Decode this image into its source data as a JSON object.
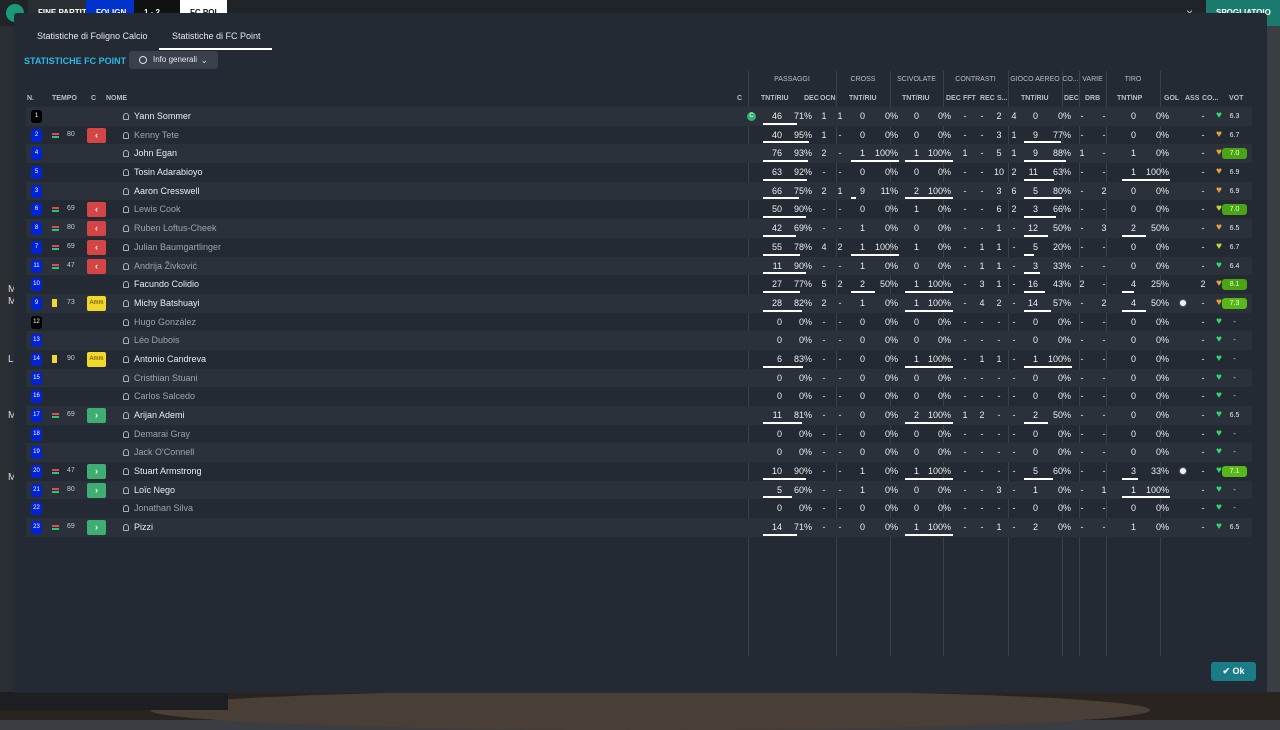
{
  "topbar": {
    "end_label": "FINE PARTITA",
    "home_team": "FOLIGN",
    "score": "1 - 2",
    "away_team": "FC POI",
    "right_label": "SPOGLIATOIO",
    "close_glyph": "×"
  },
  "left_letters": [
    "M",
    "M",
    "L",
    "M",
    "M"
  ],
  "tabs": [
    {
      "label": "Statistiche di Foligno Calcio"
    },
    {
      "label": "Statistiche di FC Point"
    }
  ],
  "section_title": "STATISTICHE FC POINT",
  "view_select": {
    "label": "Info generali"
  },
  "group_headers": {
    "passaggi": "PASSAGGI",
    "cross": "CROSS",
    "scivolate": "SCIVOLATE",
    "contrasti": "CONTRASTI",
    "gioco_aereo": "GIOCO AEREO",
    "co": "CO...",
    "varie": "VARIE",
    "tiro": "TIRO"
  },
  "columns": {
    "n": "N.",
    "tempo": "TEMPO",
    "c": "C",
    "nome": "NOME",
    "c2": "C",
    "pass_tnt": "TNT/RIU",
    "pass_dec": "DEC",
    "pass_ocn": "OCN",
    "cross_tnt": "TNT/RIU",
    "sciv_tnt": "TNT/RIU",
    "contr_dec": "DEC",
    "contr_fft": "FFT",
    "contr_rec": "REC",
    "contr_s": "S...",
    "aereo_tnt": "TNT/RIU",
    "co_dec": "DEC",
    "varie_drb": "DRB",
    "tiro_tnt": "TNT\\NP",
    "gol": "GOL",
    "ass": "ASS",
    "co2": "CO...",
    "vot": "VOT"
  },
  "players": [
    {
      "n": "1",
      "gk": true,
      "ev": "",
      "min": "",
      "role": "",
      "name": "Yann Sommer",
      "dim": false,
      "cap": true,
      "pt": "46",
      "pp": "71%",
      "pb": 0.71,
      "pd": "1",
      "po": "1",
      "ct": "0",
      "cp": "0%",
      "cb": 0,
      "st": "0",
      "sp": "0%",
      "sb": 0,
      "kd": "-",
      "kf": "-",
      "kr": "2",
      "ks": "4",
      "at": "0",
      "ap": "0%",
      "ab": 0,
      "cd": "-",
      "dr": "-",
      "tt": "0",
      "tp": "0%",
      "tb": 0,
      "gol": "",
      "ball": false,
      "ass": "-",
      "heart": "green",
      "vot": "6.3",
      "vc": ""
    },
    {
      "n": "2",
      "gk": false,
      "ev": "sub",
      "min": "80",
      "role": "out",
      "name": "Kenny Tete",
      "dim": true,
      "cap": false,
      "pt": "40",
      "pp": "95%",
      "pb": 0.95,
      "pd": "1",
      "po": "-",
      "ct": "0",
      "cp": "0%",
      "cb": 0,
      "st": "0",
      "sp": "0%",
      "sb": 0,
      "kd": "-",
      "kf": "-",
      "kr": "3",
      "ks": "1",
      "at": "9",
      "ap": "77%",
      "ab": 0.77,
      "cd": "-",
      "dr": "-",
      "tt": "0",
      "tp": "0%",
      "tb": 0,
      "gol": "",
      "ball": false,
      "ass": "-",
      "heart": "orange",
      "vot": "6.7",
      "vc": ""
    },
    {
      "n": "4",
      "gk": false,
      "ev": "",
      "min": "",
      "role": "",
      "name": "John Egan",
      "dim": false,
      "cap": false,
      "pt": "76",
      "pp": "93%",
      "pb": 0.93,
      "pd": "2",
      "po": "-",
      "ct": "1",
      "cp": "100%",
      "cb": 1,
      "st": "1",
      "sp": "100%",
      "sb": 1,
      "kd": "1",
      "kf": "-",
      "kr": "5",
      "ks": "1",
      "at": "9",
      "ap": "88%",
      "ab": 0.88,
      "cd": "1",
      "dr": "-",
      "tt": "1",
      "tp": "0%",
      "tb": 0,
      "gol": "",
      "ball": false,
      "ass": "-",
      "heart": "orange",
      "vot": "7.0",
      "vc": "hi"
    },
    {
      "n": "5",
      "gk": false,
      "ev": "",
      "min": "",
      "role": "",
      "name": "Tosin Adarabioyo",
      "dim": false,
      "cap": false,
      "pt": "63",
      "pp": "92%",
      "pb": 0.92,
      "pd": "-",
      "po": "-",
      "ct": "0",
      "cp": "0%",
      "cb": 0,
      "st": "0",
      "sp": "0%",
      "sb": 0,
      "kd": "-",
      "kf": "-",
      "kr": "10",
      "ks": "2",
      "at": "11",
      "ap": "63%",
      "ab": 0.63,
      "cd": "-",
      "dr": "-",
      "tt": "1",
      "tp": "100%",
      "tb": 1,
      "gol": "",
      "ball": false,
      "ass": "-",
      "heart": "orange",
      "vot": "6.9",
      "vc": ""
    },
    {
      "n": "3",
      "gk": false,
      "ev": "",
      "min": "",
      "role": "",
      "name": "Aaron Cresswell",
      "dim": false,
      "cap": false,
      "pt": "66",
      "pp": "75%",
      "pb": 0.75,
      "pd": "2",
      "po": "1",
      "ct": "9",
      "cp": "11%",
      "cb": 0.11,
      "st": "2",
      "sp": "100%",
      "sb": 1,
      "kd": "-",
      "kf": "-",
      "kr": "3",
      "ks": "6",
      "at": "5",
      "ap": "80%",
      "ab": 0.8,
      "cd": "-",
      "dr": "2",
      "tt": "0",
      "tp": "0%",
      "tb": 0,
      "gol": "",
      "ball": false,
      "ass": "-",
      "heart": "orange",
      "vot": "6.9",
      "vc": ""
    },
    {
      "n": "6",
      "gk": false,
      "ev": "sub",
      "min": "69",
      "role": "out",
      "name": "Lewis Cook",
      "dim": true,
      "cap": false,
      "pt": "50",
      "pp": "90%",
      "pb": 0.9,
      "pd": "-",
      "po": "-",
      "ct": "0",
      "cp": "0%",
      "cb": 0,
      "st": "1",
      "sp": "0%",
      "sb": 0,
      "kd": "-",
      "kf": "-",
      "kr": "6",
      "ks": "2",
      "at": "3",
      "ap": "66%",
      "ab": 0.66,
      "cd": "-",
      "dr": "-",
      "tt": "0",
      "tp": "0%",
      "tb": 0,
      "gol": "",
      "ball": false,
      "ass": "-",
      "heart": "yellow",
      "vot": "7.0",
      "vc": "hi"
    },
    {
      "n": "8",
      "gk": false,
      "ev": "sub",
      "min": "80",
      "role": "out",
      "name": "Ruben Loftus-Cheek",
      "dim": true,
      "cap": false,
      "pt": "42",
      "pp": "69%",
      "pb": 0.69,
      "pd": "-",
      "po": "-",
      "ct": "1",
      "cp": "0%",
      "cb": 0,
      "st": "0",
      "sp": "0%",
      "sb": 0,
      "kd": "-",
      "kf": "-",
      "kr": "1",
      "ks": "-",
      "at": "12",
      "ap": "50%",
      "ab": 0.5,
      "cd": "-",
      "dr": "3",
      "tt": "2",
      "tp": "50%",
      "tb": 0.5,
      "gol": "",
      "ball": false,
      "ass": "-",
      "heart": "orange",
      "vot": "6.5",
      "vc": ""
    },
    {
      "n": "7",
      "gk": false,
      "ev": "sub",
      "min": "69",
      "role": "out",
      "name": "Julian Baumgartlinger",
      "dim": true,
      "cap": false,
      "pt": "55",
      "pp": "78%",
      "pb": 0.78,
      "pd": "4",
      "po": "2",
      "ct": "1",
      "cp": "100%",
      "cb": 1,
      "st": "1",
      "sp": "0%",
      "sb": 0,
      "kd": "-",
      "kf": "1",
      "kr": "1",
      "ks": "-",
      "at": "5",
      "ap": "20%",
      "ab": 0.2,
      "cd": "-",
      "dr": "-",
      "tt": "0",
      "tp": "0%",
      "tb": 0,
      "gol": "",
      "ball": false,
      "ass": "-",
      "heart": "yellow",
      "vot": "6.7",
      "vc": ""
    },
    {
      "n": "11",
      "gk": false,
      "ev": "sub",
      "min": "47",
      "role": "out",
      "name": "Andrija Živković",
      "dim": true,
      "cap": false,
      "pt": "11",
      "pp": "90%",
      "pb": 0.9,
      "pd": "-",
      "po": "-",
      "ct": "1",
      "cp": "0%",
      "cb": 0,
      "st": "0",
      "sp": "0%",
      "sb": 0,
      "kd": "-",
      "kf": "1",
      "kr": "1",
      "ks": "-",
      "at": "3",
      "ap": "33%",
      "ab": 0.33,
      "cd": "-",
      "dr": "-",
      "tt": "0",
      "tp": "0%",
      "tb": 0,
      "gol": "",
      "ball": false,
      "ass": "-",
      "heart": "green",
      "vot": "6.4",
      "vc": ""
    },
    {
      "n": "10",
      "gk": false,
      "ev": "",
      "min": "",
      "role": "",
      "name": "Facundo Colidio",
      "dim": false,
      "cap": false,
      "pt": "27",
      "pp": "77%",
      "pb": 0.77,
      "pd": "5",
      "po": "2",
      "ct": "2",
      "cp": "50%",
      "cb": 0.5,
      "st": "1",
      "sp": "100%",
      "sb": 1,
      "kd": "-",
      "kf": "3",
      "kr": "1",
      "ks": "-",
      "at": "16",
      "ap": "43%",
      "ab": 0.43,
      "cd": "2",
      "dr": "-",
      "tt": "4",
      "tp": "25%",
      "tb": 0.25,
      "gol": "",
      "ball": false,
      "ass": "2",
      "heart": "orange",
      "vot": "8.1",
      "vc": "hi"
    },
    {
      "n": "9",
      "gk": false,
      "ev": "card",
      "min": "73",
      "role": "amm",
      "name": "Michy Batshuayi",
      "dim": false,
      "cap": false,
      "pt": "28",
      "pp": "82%",
      "pb": 0.82,
      "pd": "2",
      "po": "-",
      "ct": "1",
      "cp": "0%",
      "cb": 0,
      "st": "1",
      "sp": "100%",
      "sb": 1,
      "kd": "-",
      "kf": "4",
      "kr": "2",
      "ks": "-",
      "at": "14",
      "ap": "57%",
      "ab": 0.57,
      "cd": "-",
      "dr": "2",
      "tt": "4",
      "tp": "50%",
      "tb": 0.5,
      "gol": "",
      "ball": true,
      "ass": "-",
      "heart": "orange",
      "vot": "7.3",
      "vc": "hi2"
    },
    {
      "n": "12",
      "gk": true,
      "ev": "",
      "min": "",
      "role": "",
      "name": "Hugo González",
      "dim": true,
      "cap": false,
      "pt": "0",
      "pp": "0%",
      "pb": 0,
      "pd": "-",
      "po": "-",
      "ct": "0",
      "cp": "0%",
      "cb": 0,
      "st": "0",
      "sp": "0%",
      "sb": 0,
      "kd": "-",
      "kf": "-",
      "kr": "-",
      "ks": "-",
      "at": "0",
      "ap": "0%",
      "ab": 0,
      "cd": "-",
      "dr": "-",
      "tt": "0",
      "tp": "0%",
      "tb": 0,
      "gol": "",
      "ball": false,
      "ass": "-",
      "heart": "green",
      "vot": "-",
      "vc": ""
    },
    {
      "n": "13",
      "gk": false,
      "ev": "",
      "min": "",
      "role": "",
      "name": "Léo Dubois",
      "dim": true,
      "cap": false,
      "pt": "0",
      "pp": "0%",
      "pb": 0,
      "pd": "-",
      "po": "-",
      "ct": "0",
      "cp": "0%",
      "cb": 0,
      "st": "0",
      "sp": "0%",
      "sb": 0,
      "kd": "-",
      "kf": "-",
      "kr": "-",
      "ks": "-",
      "at": "0",
      "ap": "0%",
      "ab": 0,
      "cd": "-",
      "dr": "-",
      "tt": "0",
      "tp": "0%",
      "tb": 0,
      "gol": "",
      "ball": false,
      "ass": "-",
      "heart": "green",
      "vot": "-",
      "vc": ""
    },
    {
      "n": "14",
      "gk": false,
      "ev": "card",
      "min": "90",
      "role": "amm",
      "name": "Antonio Candreva",
      "dim": false,
      "cap": false,
      "pt": "6",
      "pp": "83%",
      "pb": 0.83,
      "pd": "-",
      "po": "-",
      "ct": "0",
      "cp": "0%",
      "cb": 0,
      "st": "1",
      "sp": "100%",
      "sb": 1,
      "kd": "-",
      "kf": "1",
      "kr": "1",
      "ks": "-",
      "at": "1",
      "ap": "100%",
      "ab": 1,
      "cd": "-",
      "dr": "-",
      "tt": "0",
      "tp": "0%",
      "tb": 0,
      "gol": "",
      "ball": false,
      "ass": "-",
      "heart": "green",
      "vot": "-",
      "vc": ""
    },
    {
      "n": "15",
      "gk": false,
      "ev": "",
      "min": "",
      "role": "",
      "name": "Cristhian Stuani",
      "dim": true,
      "cap": false,
      "pt": "0",
      "pp": "0%",
      "pb": 0,
      "pd": "-",
      "po": "-",
      "ct": "0",
      "cp": "0%",
      "cb": 0,
      "st": "0",
      "sp": "0%",
      "sb": 0,
      "kd": "-",
      "kf": "-",
      "kr": "-",
      "ks": "-",
      "at": "0",
      "ap": "0%",
      "ab": 0,
      "cd": "-",
      "dr": "-",
      "tt": "0",
      "tp": "0%",
      "tb": 0,
      "gol": "",
      "ball": false,
      "ass": "-",
      "heart": "green",
      "vot": "-",
      "vc": ""
    },
    {
      "n": "16",
      "gk": false,
      "ev": "",
      "min": "",
      "role": "",
      "name": "Carlos Salcedo",
      "dim": true,
      "cap": false,
      "pt": "0",
      "pp": "0%",
      "pb": 0,
      "pd": "-",
      "po": "-",
      "ct": "0",
      "cp": "0%",
      "cb": 0,
      "st": "0",
      "sp": "0%",
      "sb": 0,
      "kd": "-",
      "kf": "-",
      "kr": "-",
      "ks": "-",
      "at": "0",
      "ap": "0%",
      "ab": 0,
      "cd": "-",
      "dr": "-",
      "tt": "0",
      "tp": "0%",
      "tb": 0,
      "gol": "",
      "ball": false,
      "ass": "-",
      "heart": "green",
      "vot": "-",
      "vc": ""
    },
    {
      "n": "17",
      "gk": false,
      "ev": "sub",
      "min": "69",
      "role": "in",
      "name": "Arijan Ademi",
      "dim": false,
      "cap": false,
      "pt": "11",
      "pp": "81%",
      "pb": 0.81,
      "pd": "-",
      "po": "-",
      "ct": "0",
      "cp": "0%",
      "cb": 0,
      "st": "2",
      "sp": "100%",
      "sb": 1,
      "kd": "1",
      "kf": "2",
      "kr": "-",
      "ks": "-",
      "at": "2",
      "ap": "50%",
      "ab": 0.5,
      "cd": "-",
      "dr": "-",
      "tt": "0",
      "tp": "0%",
      "tb": 0,
      "gol": "",
      "ball": false,
      "ass": "-",
      "heart": "green",
      "vot": "6.5",
      "vc": ""
    },
    {
      "n": "18",
      "gk": false,
      "ev": "",
      "min": "",
      "role": "",
      "name": "Demarai Gray",
      "dim": true,
      "cap": false,
      "pt": "0",
      "pp": "0%",
      "pb": 0,
      "pd": "-",
      "po": "-",
      "ct": "0",
      "cp": "0%",
      "cb": 0,
      "st": "0",
      "sp": "0%",
      "sb": 0,
      "kd": "-",
      "kf": "-",
      "kr": "-",
      "ks": "-",
      "at": "0",
      "ap": "0%",
      "ab": 0,
      "cd": "-",
      "dr": "-",
      "tt": "0",
      "tp": "0%",
      "tb": 0,
      "gol": "",
      "ball": false,
      "ass": "-",
      "heart": "green",
      "vot": "-",
      "vc": ""
    },
    {
      "n": "19",
      "gk": false,
      "ev": "",
      "min": "",
      "role": "",
      "name": "Jack O'Connell",
      "dim": true,
      "cap": false,
      "pt": "0",
      "pp": "0%",
      "pb": 0,
      "pd": "-",
      "po": "-",
      "ct": "0",
      "cp": "0%",
      "cb": 0,
      "st": "0",
      "sp": "0%",
      "sb": 0,
      "kd": "-",
      "kf": "-",
      "kr": "-",
      "ks": "-",
      "at": "0",
      "ap": "0%",
      "ab": 0,
      "cd": "-",
      "dr": "-",
      "tt": "0",
      "tp": "0%",
      "tb": 0,
      "gol": "",
      "ball": false,
      "ass": "-",
      "heart": "green",
      "vot": "-",
      "vc": ""
    },
    {
      "n": "20",
      "gk": false,
      "ev": "sub",
      "min": "47",
      "role": "in",
      "name": "Stuart Armstrong",
      "dim": false,
      "cap": false,
      "pt": "10",
      "pp": "90%",
      "pb": 0.9,
      "pd": "-",
      "po": "-",
      "ct": "1",
      "cp": "0%",
      "cb": 0,
      "st": "1",
      "sp": "100%",
      "sb": 1,
      "kd": "-",
      "kf": "-",
      "kr": "-",
      "ks": "-",
      "at": "5",
      "ap": "60%",
      "ab": 0.6,
      "cd": "-",
      "dr": "-",
      "tt": "3",
      "tp": "33%",
      "tb": 0.33,
      "gol": "",
      "ball": true,
      "ass": "-",
      "heart": "green",
      "vot": "7.1",
      "vc": "hi2"
    },
    {
      "n": "21",
      "gk": false,
      "ev": "sub",
      "min": "80",
      "role": "in",
      "name": "Loïc Nego",
      "dim": false,
      "cap": false,
      "pt": "5",
      "pp": "60%",
      "pb": 0.6,
      "pd": "-",
      "po": "-",
      "ct": "1",
      "cp": "0%",
      "cb": 0,
      "st": "0",
      "sp": "0%",
      "sb": 0,
      "kd": "-",
      "kf": "-",
      "kr": "3",
      "ks": "-",
      "at": "1",
      "ap": "0%",
      "ab": 0,
      "cd": "-",
      "dr": "1",
      "tt": "1",
      "tp": "100%",
      "tb": 1,
      "gol": "",
      "ball": false,
      "ass": "-",
      "heart": "green",
      "vot": "-",
      "vc": ""
    },
    {
      "n": "22",
      "gk": false,
      "ev": "",
      "min": "",
      "role": "",
      "name": "Jonathan Silva",
      "dim": true,
      "cap": false,
      "pt": "0",
      "pp": "0%",
      "pb": 0,
      "pd": "-",
      "po": "-",
      "ct": "0",
      "cp": "0%",
      "cb": 0,
      "st": "0",
      "sp": "0%",
      "sb": 0,
      "kd": "-",
      "kf": "-",
      "kr": "-",
      "ks": "-",
      "at": "0",
      "ap": "0%",
      "ab": 0,
      "cd": "-",
      "dr": "-",
      "tt": "0",
      "tp": "0%",
      "tb": 0,
      "gol": "",
      "ball": false,
      "ass": "-",
      "heart": "green",
      "vot": "-",
      "vc": ""
    },
    {
      "n": "23",
      "gk": false,
      "ev": "sub",
      "min": "69",
      "role": "in",
      "name": "Pizzi",
      "dim": false,
      "cap": false,
      "pt": "14",
      "pp": "71%",
      "pb": 0.71,
      "pd": "-",
      "po": "-",
      "ct": "0",
      "cp": "0%",
      "cb": 0,
      "st": "1",
      "sp": "100%",
      "sb": 1,
      "kd": "-",
      "kf": "-",
      "kr": "1",
      "ks": "-",
      "at": "2",
      "ap": "0%",
      "ab": 0,
      "cd": "-",
      "dr": "-",
      "tt": "1",
      "tp": "0%",
      "tb": 0,
      "gol": "",
      "ball": false,
      "ass": "-",
      "heart": "green",
      "vot": "6.5",
      "vc": ""
    }
  ],
  "labels": {
    "amm": "Amm",
    "cap_letter": "C",
    "arrow_out": "‹",
    "arrow_in": "›",
    "heart_glyph": "♥"
  },
  "colors": {
    "heart_green": "#2fd86a",
    "heart_orange": "#e8a33a",
    "heart_yellow": "#c9d82f",
    "accent": "#2ab8e6"
  },
  "ok_button": {
    "label": "✔ Ok"
  }
}
